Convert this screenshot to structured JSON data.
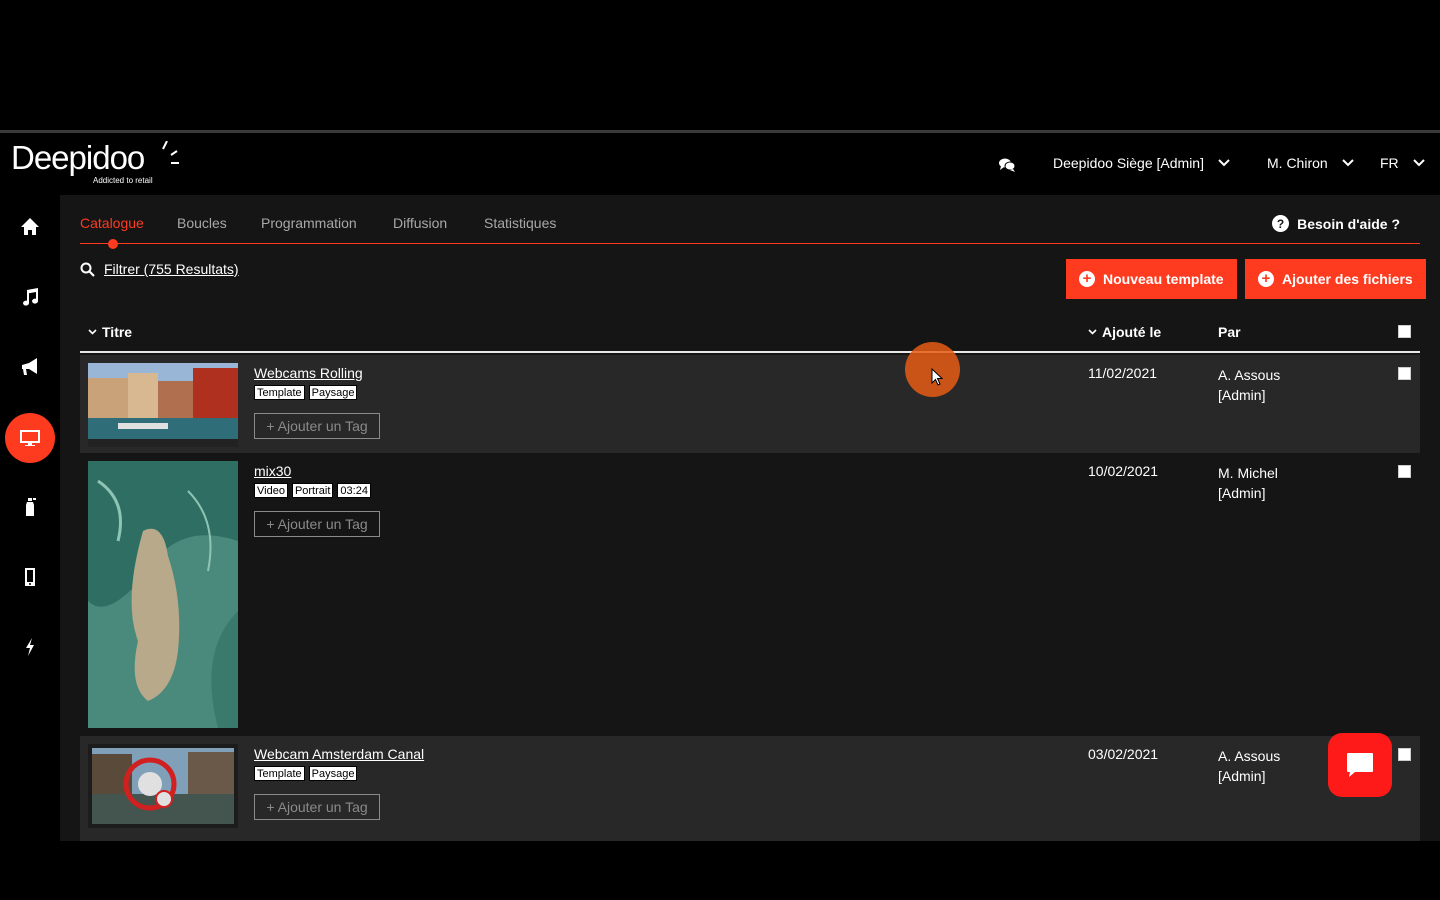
{
  "header": {
    "logo_text": "Deepidoo",
    "logo_tagline": "Addicted to retail",
    "org_selector": "Deepidoo Siège [Admin]",
    "user_selector": "M. Chiron",
    "lang_selector": "FR"
  },
  "sidebar": {
    "items": [
      {
        "icon": "home-icon"
      },
      {
        "icon": "music-icon"
      },
      {
        "icon": "megaphone-icon"
      },
      {
        "icon": "screen-icon",
        "active": true
      },
      {
        "icon": "spray-bottle-icon"
      },
      {
        "icon": "mobile-icon"
      },
      {
        "icon": "lightning-icon"
      }
    ]
  },
  "tabs": [
    {
      "label": "Catalogue",
      "active": true
    },
    {
      "label": "Boucles"
    },
    {
      "label": "Programmation"
    },
    {
      "label": "Diffusion"
    },
    {
      "label": "Statistiques"
    }
  ],
  "help_label": "Besoin d'aide ?",
  "filter_label": "Filtrer (755 Resultats)",
  "buttons": {
    "new_template": "Nouveau template",
    "add_files": "Ajouter des fichiers"
  },
  "table": {
    "headers": {
      "title": "Titre",
      "added": "Ajouté le",
      "by": "Par"
    },
    "add_tag_label": "+ Ajouter un Tag",
    "rows": [
      {
        "title": "Webcams Rolling",
        "tags": [
          "Template",
          "Paysage"
        ],
        "date": "11/02/2021",
        "by_name": "A. Assous",
        "by_role": "[Admin]"
      },
      {
        "title": "mix30",
        "tags": [
          "Video",
          "Portrait",
          "03:24"
        ],
        "date": "10/02/2021",
        "by_name": "M. Michel",
        "by_role": "[Admin]"
      },
      {
        "title": "Webcam Amsterdam Canal",
        "tags": [
          "Template",
          "Paysage"
        ],
        "date": "03/02/2021",
        "by_name": "A. Assous",
        "by_role": "[Admin]"
      }
    ]
  },
  "colors": {
    "accent": "#ff3b1f",
    "background": "#151515",
    "row_alt": "#282828"
  }
}
